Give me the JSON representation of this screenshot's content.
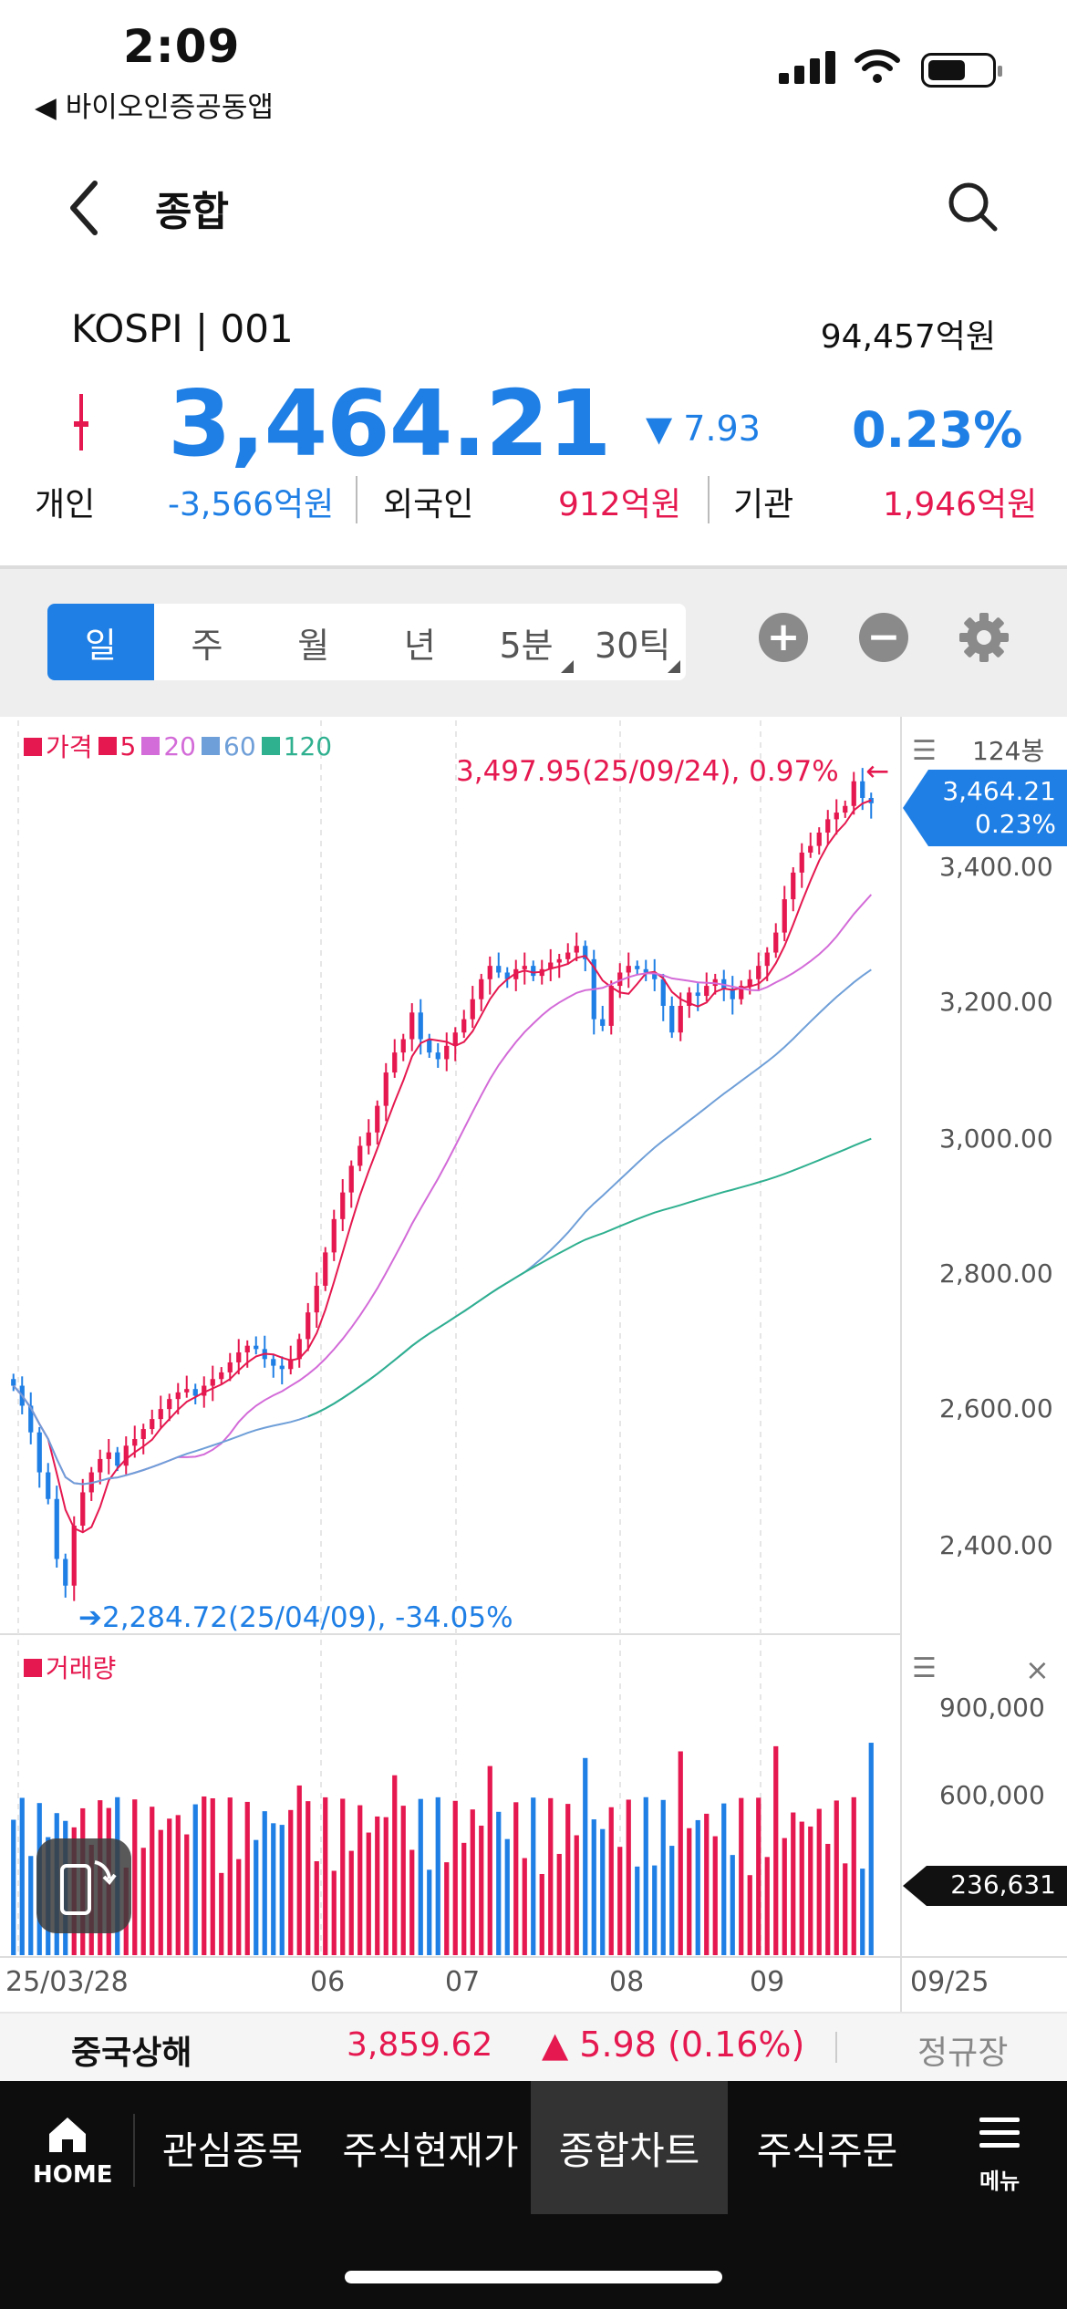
{
  "status": {
    "time": "2:09",
    "back_app": "◀ 바이오인증공동앱"
  },
  "header": {
    "title": "종합"
  },
  "quote": {
    "name": "KOSPI | 001",
    "turnover": "94,457억원",
    "price": "3,464.21",
    "change": "▼ 7.93",
    "change_pct": "0.23%",
    "investors": [
      {
        "label": "개인",
        "value": "-3,566억원",
        "color": "#1f7fe5"
      },
      {
        "label": "외국인",
        "value": "912억원",
        "color": "#e5184f"
      },
      {
        "label": "기관",
        "value": "1,946억원",
        "color": "#e5184f"
      }
    ]
  },
  "toolbar": {
    "periods": [
      "일",
      "주",
      "월",
      "년",
      "5분",
      "30틱"
    ],
    "active_period": "일",
    "zoom_in": "+",
    "zoom_out": "−"
  },
  "chart": {
    "legend": [
      {
        "label": "가격",
        "color": "#e5184f"
      },
      {
        "label": "5",
        "color": "#e5184f"
      },
      {
        "label": "20",
        "color": "#d36bd8"
      },
      {
        "label": "60",
        "color": "#6f9fd8"
      },
      {
        "label": "120",
        "color": "#2fb08f"
      }
    ],
    "bars_count": "124봉",
    "high_label": "3,497.95(25/09/24), 0.97%",
    "high_arrow": "←",
    "low_label": "➔2,284.72(25/04/09), -34.05%",
    "tag_price": "3,464.21",
    "tag_pct": "0.23%",
    "y_ticks": [
      "3,400.00",
      "3,200.00",
      "3,000.00",
      "2,800.00",
      "2,600.00",
      "2,400.00"
    ],
    "volume_title": "거래량",
    "volume_ticks": [
      "900,000",
      "600,000"
    ],
    "volume_tag": "236,631",
    "x_ticks": [
      "25/03/28",
      "06",
      "07",
      "08",
      "09",
      "09/25"
    ],
    "close_label": "×",
    "menu_label": "☰"
  },
  "chart_data": {
    "type": "candlestick",
    "title": "",
    "x_labels": [
      "25/03/28",
      "06",
      "07",
      "08",
      "09",
      "09/25"
    ],
    "ylim": [
      2250,
      3550
    ],
    "high": {
      "value": 3497.95,
      "date": "25/09/24",
      "pct": 0.97
    },
    "low": {
      "value": 2284.72,
      "date": "25/04/09",
      "pct": -34.05
    },
    "last_close": 3464.21,
    "closes": [
      2590,
      2560,
      2520,
      2460,
      2420,
      2330,
      2290,
      2380,
      2430,
      2460,
      2480,
      2490,
      2470,
      2500,
      2510,
      2525,
      2540,
      2555,
      2570,
      2580,
      2585,
      2575,
      2590,
      2600,
      2610,
      2625,
      2640,
      2650,
      2645,
      2630,
      2620,
      2615,
      2630,
      2660,
      2700,
      2740,
      2790,
      2840,
      2880,
      2920,
      2950,
      2970,
      3010,
      3060,
      3090,
      3110,
      3150,
      3110,
      3090,
      3080,
      3100,
      3120,
      3140,
      3170,
      3200,
      3220,
      3210,
      3200,
      3215,
      3220,
      3205,
      3215,
      3225,
      3230,
      3240,
      3250,
      3230,
      3140,
      3130,
      3190,
      3210,
      3220,
      3215,
      3210,
      3200,
      3160,
      3120,
      3160,
      3180,
      3175,
      3190,
      3200,
      3185,
      3170,
      3190,
      3200,
      3220,
      3240,
      3270,
      3320,
      3360,
      3390,
      3400,
      3420,
      3440,
      3450,
      3460,
      3497,
      3472,
      3464
    ],
    "ma_periods": [
      5,
      20,
      60,
      120
    ],
    "volume": {
      "last": 236631,
      "yticks": [
        900000,
        600000
      ]
    }
  },
  "ticker": {
    "name": "중국상해",
    "value": "3,859.62",
    "change": "▲ 5.98 (0.16%)",
    "market": "정규장"
  },
  "nav": {
    "home": "HOME",
    "items": [
      "관심종목",
      "주식현재가",
      "종합차트",
      "주식주문"
    ],
    "active": "종합차트",
    "menu": "메뉴"
  }
}
